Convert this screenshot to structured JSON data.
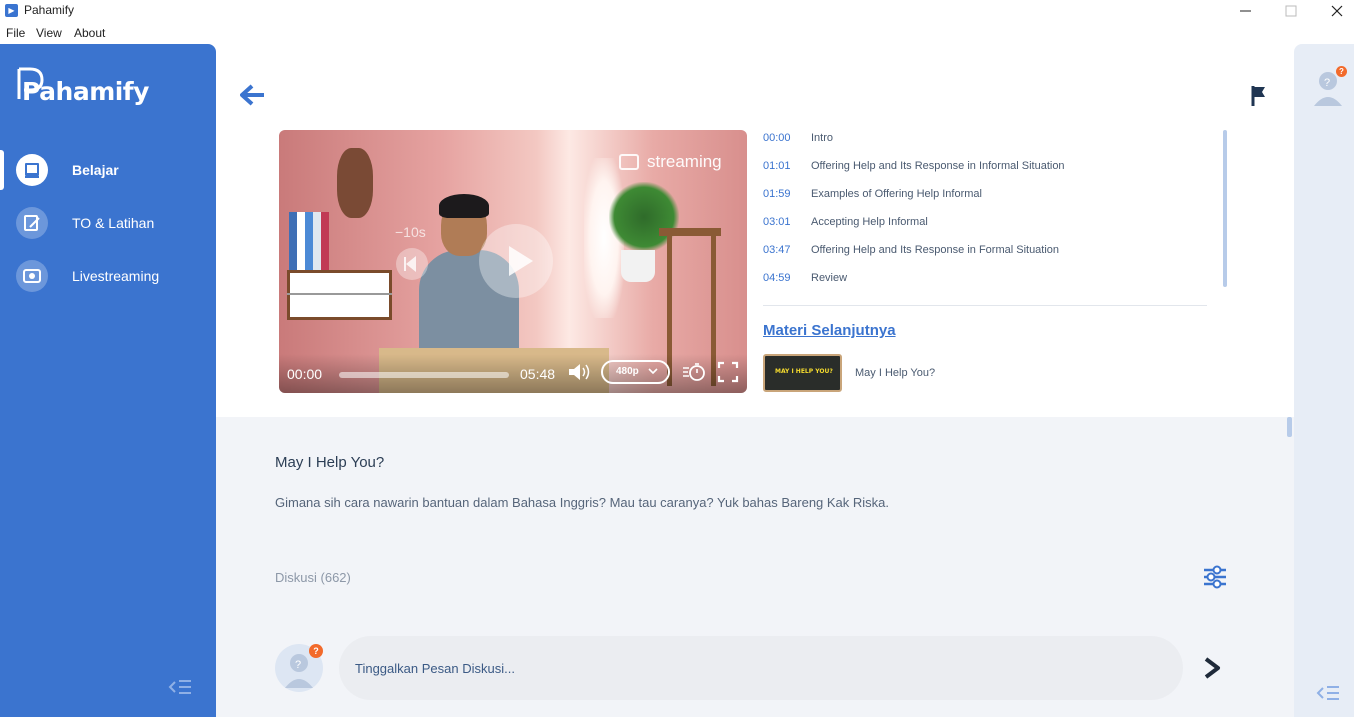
{
  "window": {
    "title": "Pahamify"
  },
  "menu": {
    "file": "File",
    "view": "View",
    "about": "About"
  },
  "sidebar": {
    "logo": "Pahamify",
    "items": [
      {
        "label": "Belajar",
        "icon": "book-icon",
        "active": true
      },
      {
        "label": "TO & Latihan",
        "icon": "edit-icon",
        "active": false
      },
      {
        "label": "Livestreaming",
        "icon": "live-icon",
        "active": false
      }
    ]
  },
  "video": {
    "stream_label": "streaming",
    "rewind_label": "−10s",
    "current_time": "00:00",
    "duration": "05:48",
    "progress": 0.0,
    "quality": "480p"
  },
  "chapters": [
    {
      "time": "00:00",
      "label": "Intro"
    },
    {
      "time": "01:01",
      "label": "Offering Help and Its Response in Informal Situation"
    },
    {
      "time": "01:59",
      "label": "Examples of Offering Help Informal"
    },
    {
      "time": "03:01",
      "label": "Accepting Help Informal"
    },
    {
      "time": "03:47",
      "label": "Offering Help and Its Response in Formal Situation"
    },
    {
      "time": "04:59",
      "label": "Review"
    }
  ],
  "next": {
    "heading": "Materi Selanjutnya",
    "thumb_text": "MAY I HELP YOU?",
    "title": "May I Help You?"
  },
  "lesson": {
    "title": "May I Help You?",
    "description": "Gimana sih cara nawarin bantuan dalam Bahasa Inggris? Mau tau caranya? Yuk bahas Bareng Kak Riska."
  },
  "discussion": {
    "count_label": "Diskusi (662)",
    "placeholder": "Tinggalkan Pesan Diskusi...",
    "badge": "?"
  },
  "colors": {
    "brand": "#3b74cf",
    "accent": "#f26a2b",
    "sidebar_bg": "#3b74cf",
    "lower_bg": "#f2f4f8"
  }
}
